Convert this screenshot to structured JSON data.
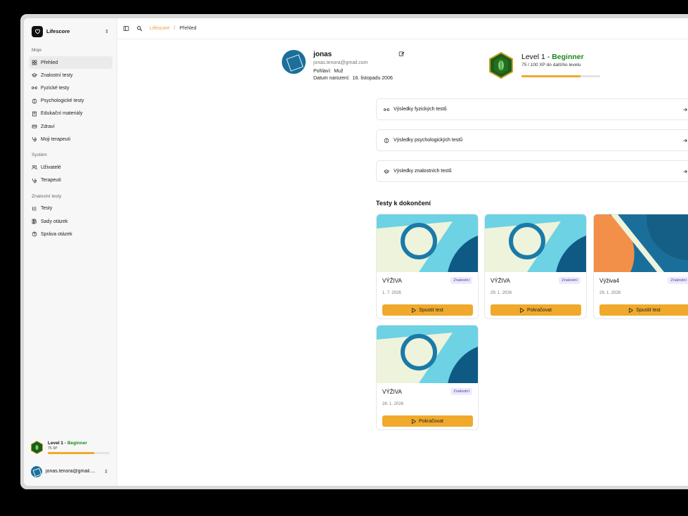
{
  "app": {
    "name": "Lifescore",
    "logo_icon": "heart-icon"
  },
  "sidebar": {
    "sections": [
      {
        "label": "Moje",
        "items": [
          {
            "label": "Přehled",
            "icon": "grid-icon",
            "active": true
          },
          {
            "label": "Znalostní testy",
            "icon": "graduation-cap-icon"
          },
          {
            "label": "Fyzické testy",
            "icon": "dumbbell-icon"
          },
          {
            "label": "Psychologické testy",
            "icon": "brain-icon"
          },
          {
            "label": "Edukační materiály",
            "icon": "book-icon"
          },
          {
            "label": "Zdraví",
            "icon": "health-icon"
          },
          {
            "label": "Moji terapeuti",
            "icon": "stethoscope-icon"
          }
        ]
      },
      {
        "label": "Systém",
        "items": [
          {
            "label": "Uživatelé",
            "icon": "users-icon"
          },
          {
            "label": "Terapeuti",
            "icon": "stethoscope-icon"
          }
        ]
      },
      {
        "label": "Znalostní testy",
        "items": [
          {
            "label": "Testy",
            "icon": "list-icon"
          },
          {
            "label": "Sady otázek",
            "icon": "library-icon"
          },
          {
            "label": "Správa otázek",
            "icon": "question-icon"
          }
        ]
      }
    ],
    "level": {
      "prefix": "Level 1 - ",
      "name": "Beginner",
      "xp": "75 XP",
      "progress": 0.75
    },
    "user_email": "jonas.tenora@gmail...."
  },
  "breadcrumb": {
    "parent": "Lifescore",
    "separator": "/",
    "current": "Přehled"
  },
  "profile": {
    "name": "jonas",
    "email": "jonas.tenora@gmail.com",
    "gender_label": "Pohlaví:",
    "gender_value": "Muž",
    "birth_label": "Datum narození:",
    "birth_value": "16. listopadu 2006"
  },
  "level": {
    "prefix": "Level 1 - ",
    "name": "Beginner",
    "xp_current": "75",
    "xp_sep": " / ",
    "xp_total": "100",
    "xp_suffix": " XP do dalšího levelu",
    "progress": 0.75
  },
  "results": [
    {
      "label": "Výsledky fyzických testů",
      "icon": "dumbbell-icon"
    },
    {
      "label": "Výsledky psychologických testů",
      "icon": "brain-icon"
    },
    {
      "label": "Výsledky znalostních testů",
      "icon": "graduation-cap-icon"
    }
  ],
  "tests_section_title": "Testy k dokončení",
  "tests": [
    {
      "title": "VÝŽIVA",
      "badge": "Znalostní",
      "date": "1. 7. 2026",
      "button": "Spustit test",
      "cover": "circle"
    },
    {
      "title": "VÝŽIVA",
      "badge": "Znalostní",
      "date": "29. 1. 2026",
      "button": "Pokračovat",
      "cover": "circle"
    },
    {
      "title": "Výživa4",
      "badge": "Znalostní",
      "date": "29. 1. 2026",
      "button": "Spustit test",
      "cover": "stripe"
    },
    {
      "title": "VÝŽIVA",
      "badge": "Znalostní",
      "date": "28. 1. 2026",
      "button": "Pokračovat",
      "cover": "circle"
    }
  ],
  "colors": {
    "accent": "#f0a92a",
    "level": "#1a8a1a",
    "breadcrumb": "#e8a13a"
  }
}
